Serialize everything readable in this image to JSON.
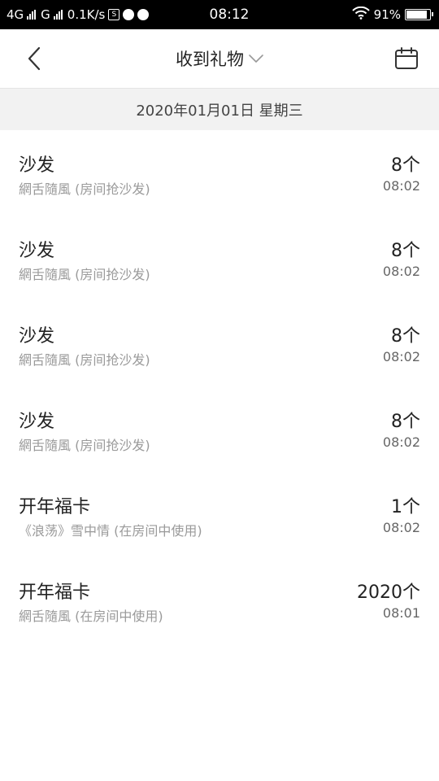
{
  "status_bar": {
    "net1": "4G",
    "net2": "G",
    "speed": "0.1K/s",
    "s_icon_label": "S",
    "time": "08:12",
    "battery": "91%",
    "battery_level": 0.91
  },
  "nav": {
    "title": "收到礼物",
    "back_icon": "chevron-left-icon",
    "dropdown_icon": "chevron-down-icon",
    "calendar_icon": "calendar-icon"
  },
  "date_header": "2020年01月01日 星期三",
  "items": [
    {
      "name": "沙发",
      "sub": "網舌隨風 (房间抢沙发)",
      "count": "8个",
      "time": "08:02"
    },
    {
      "name": "沙发",
      "sub": "網舌隨風 (房间抢沙发)",
      "count": "8个",
      "time": "08:02"
    },
    {
      "name": "沙发",
      "sub": "網舌隨風 (房间抢沙发)",
      "count": "8个",
      "time": "08:02"
    },
    {
      "name": "沙发",
      "sub": "網舌隨風 (房间抢沙发)",
      "count": "8个",
      "time": "08:02"
    },
    {
      "name": "开年福卡",
      "sub": "《浪荡》雪中情 (在房间中使用)",
      "count": "1个",
      "time": "08:02"
    },
    {
      "name": "开年福卡",
      "sub": "網舌隨風 (在房间中使用)",
      "count": "2020个",
      "time": "08:01"
    }
  ]
}
